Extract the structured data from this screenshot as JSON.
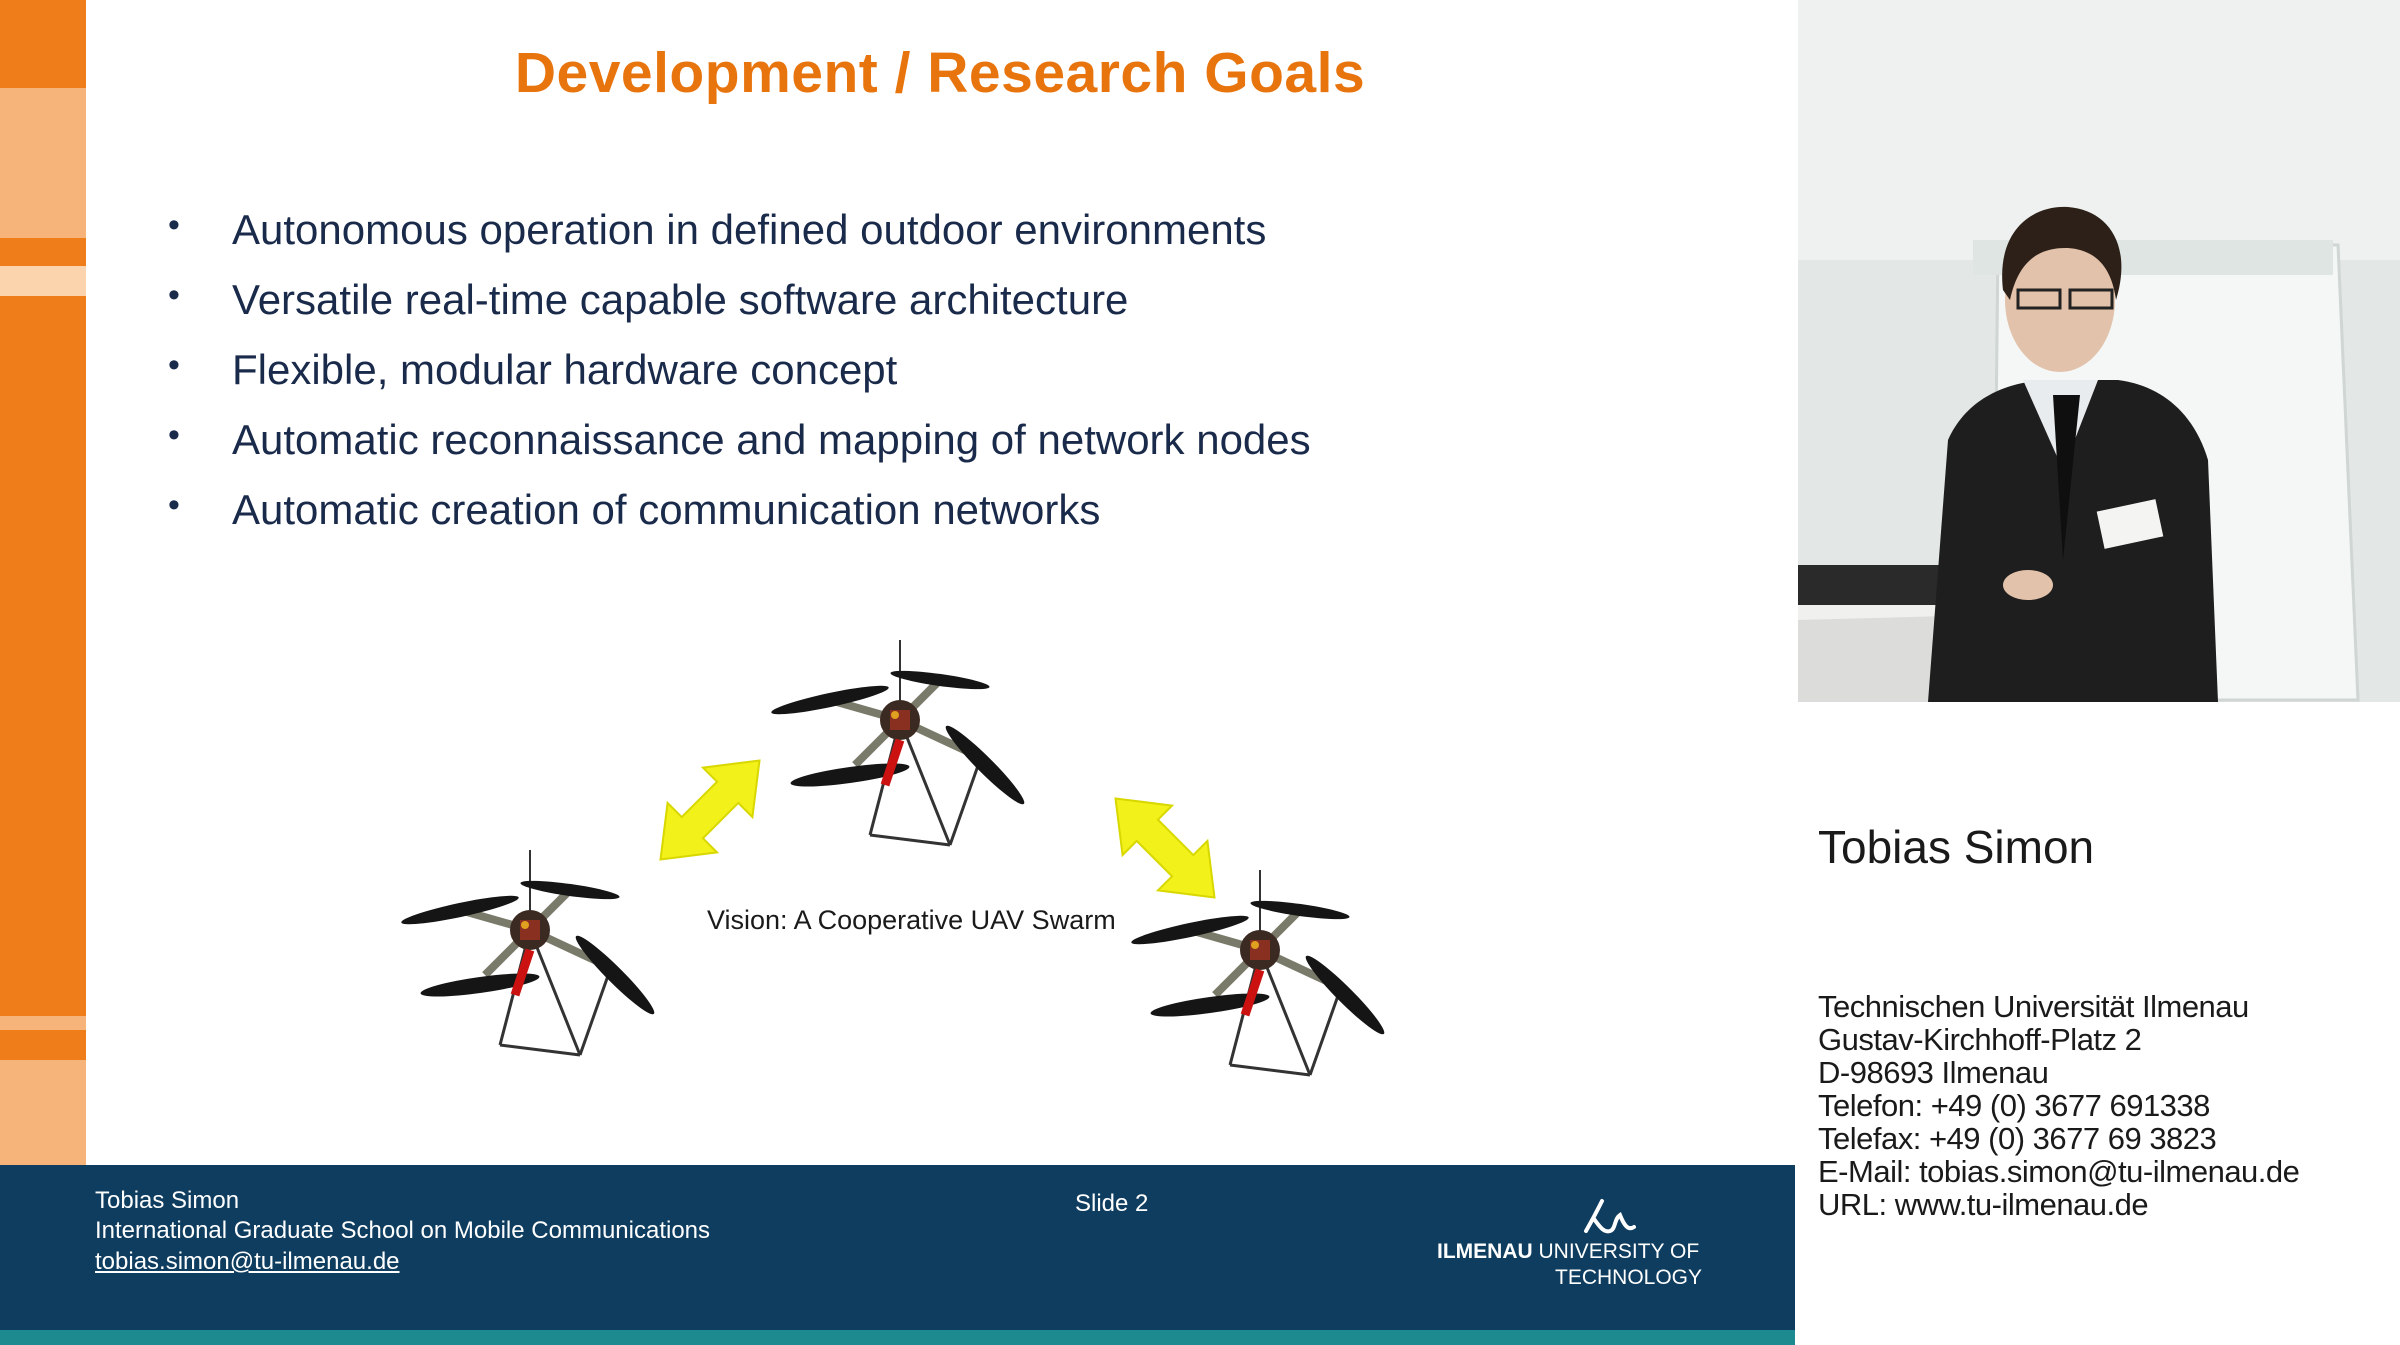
{
  "slide": {
    "title": "Development / Research Goals",
    "bullets": [
      "Autonomous operation in defined outdoor environments",
      "Versatile real-time capable software architecture",
      "Flexible, modular hardware concept",
      "Automatic reconnaissance and mapping of network nodes",
      "Automatic creation of communication networks"
    ],
    "bullet_symbol": "•",
    "diagram_caption": "Vision: A Cooperative UAV Swarm",
    "colors": {
      "title": "#e8740d",
      "stripe_dark": "#ef7d1a",
      "stripe_light": "#f7b47a",
      "footer": "#0f3d5f",
      "arrow": "#f2f21a"
    }
  },
  "footer": {
    "author": "Tobias Simon",
    "school": "International Graduate School on Mobile Communications",
    "email": "tobias.simon@tu-ilmenau.de",
    "slide_number": "Slide 2",
    "logo_bold": "ILMENAU",
    "logo_rest": "UNIVERSITY OF",
    "logo_line2": "TECHNOLOGY"
  },
  "speaker": {
    "name": "Tobias Simon",
    "contact": [
      "Technischen Universität Ilmenau",
      "Gustav-Kirchhoff-Platz 2",
      "D-98693 Ilmenau",
      "Telefon: +49 (0) 3677 691338",
      "Telefax: +49 (0) 3677 69 3823",
      "E-Mail: tobias.simon@tu-ilmenau.de",
      "URL: www.tu-ilmenau.de"
    ]
  }
}
